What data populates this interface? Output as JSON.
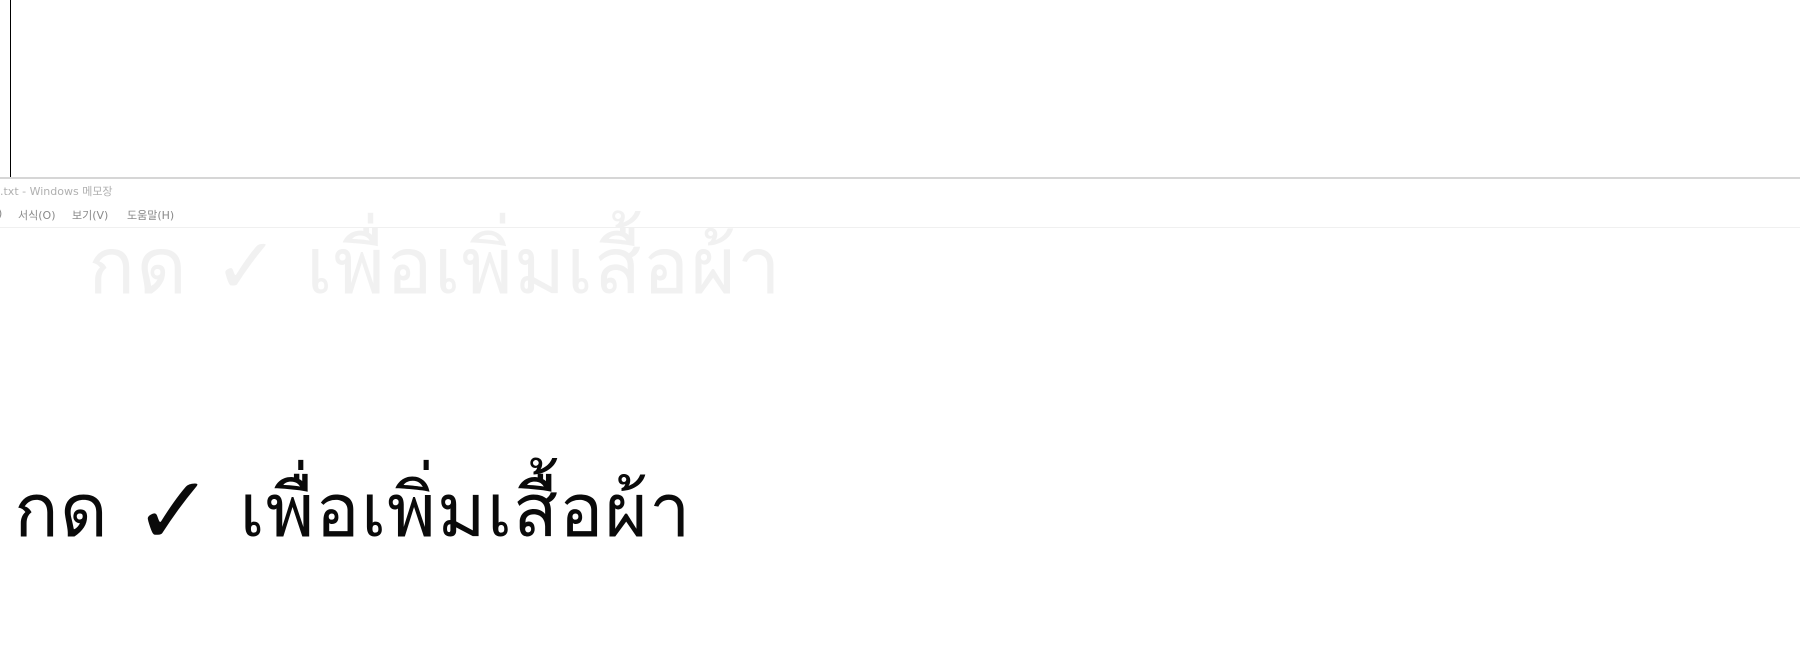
{
  "window": {
    "title": ".txt - Windows 메모장"
  },
  "menu": {
    "file": ")",
    "format": "서식(O)",
    "view": "보기(V)",
    "help": "도움말(H)"
  },
  "ghost": {
    "text": "กด ✓ เพื่อเพิ่มเสื้อผ้า"
  },
  "editor": {
    "text_before": "กด ",
    "check_glyph": "✓",
    "text_after": " เพื่อเพิ่มเสื้อผ้า"
  }
}
